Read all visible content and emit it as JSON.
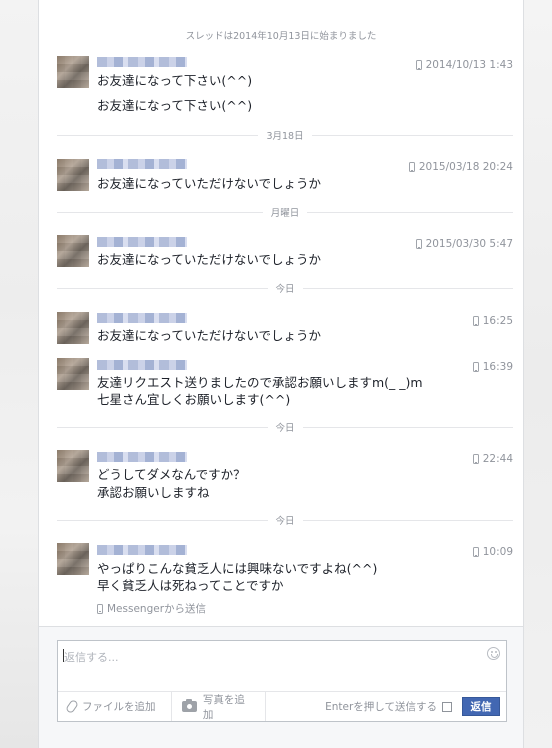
{
  "thread": {
    "started": "スレッドは2014年10月13日に始まりました"
  },
  "messages": [
    {
      "time": "2014/10/13 1:43",
      "lines": [
        "お友達になって下さい(^^)",
        "お友達になって下さい(^^)"
      ]
    },
    {
      "time": "2015/03/18 20:24",
      "lines": [
        "お友達になっていただけないでしょうか"
      ]
    },
    {
      "time": "2015/03/30 5:47",
      "lines": [
        "お友達になっていただけないでしょうか"
      ]
    },
    {
      "time": "16:25",
      "lines": [
        "お友達になっていただけないでしょうか"
      ]
    },
    {
      "time": "16:39",
      "lines": [
        "友達リクエスト送りましたので承認お願いしますm(_ _)m",
        "七星さん宜しくお願いします(^^)"
      ]
    },
    {
      "time": "22:44",
      "lines": [
        "どうしてダメなんですか？",
        "承認お願いしますね"
      ]
    },
    {
      "time": "10:09",
      "lines": [
        "やっぱりこんな貧乏人には興味ないですよね(^^)",
        "早く貧乏人は死ねってことですか"
      ]
    }
  ],
  "dividers": [
    "3月18日",
    "月曜日",
    "今日",
    "今日",
    "今日"
  ],
  "via": "Messengerから送信",
  "composer": {
    "placeholder": "返信する...",
    "attach_file": "ファイルを追加",
    "attach_photo": "写真を追加",
    "enter_to_send": "Enterを押して送信する",
    "send": "返信"
  },
  "icons": [
    "phone-icon",
    "paperclip-icon",
    "camera-icon",
    "emoji-icon"
  ],
  "colors": {
    "send_button": "#4267b2",
    "meta_text": "#90949c"
  }
}
